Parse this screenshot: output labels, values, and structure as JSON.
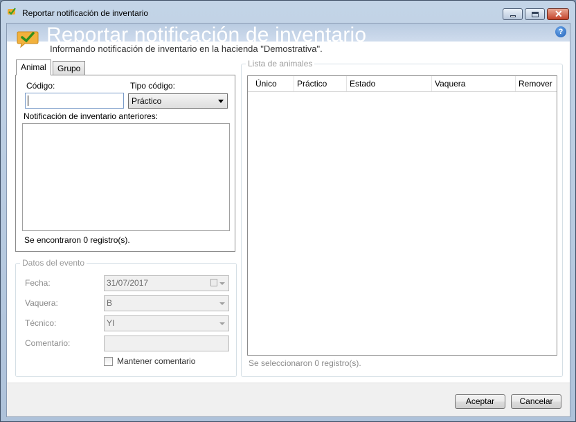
{
  "window": {
    "title": "Reportar notificación de inventario"
  },
  "header": {
    "title": "Reportar notificación de inventario",
    "subtitle": "Informando notificación de inventario en la hacienda \"Demostrativa\"."
  },
  "tabs": [
    {
      "label": "Animal",
      "active": true
    },
    {
      "label": "Grupo",
      "active": false
    }
  ],
  "animal_tab": {
    "codigo_label": "Código:",
    "codigo_value": "",
    "tipo_codigo_label": "Tipo código:",
    "tipo_codigo_value": "Práctico",
    "anteriores_label": "Notificación de inventario anteriores:",
    "registros_text": "Se encontraron 0 registro(s)."
  },
  "evento": {
    "title": "Datos del evento",
    "fecha_label": "Fecha:",
    "fecha_value": "31/07/2017",
    "vaquera_label": "Vaquera:",
    "vaquera_value": "B",
    "tecnico_label": "Técnico:",
    "tecnico_value": "YI",
    "comentario_label": "Comentario:",
    "comentario_value": "",
    "mantener_label": "Mantener comentario",
    "mantener_checked": false
  },
  "lista": {
    "title": "Lista de animales",
    "columns": [
      "Único",
      "Práctico",
      "Estado",
      "Vaquera",
      "Remover"
    ],
    "footer": "Se seleccionaron 0 registro(s)."
  },
  "buttons": {
    "aceptar": "Aceptar",
    "cancelar": "Cancelar"
  },
  "icons": {
    "title_icon": "check-bubble-icon",
    "header_icon": "check-bubble-icon",
    "help_icon": "help-icon",
    "help_glyph": "?"
  },
  "colors": {
    "frame": "#aec2da",
    "header_band": "#b9cbe1",
    "check_green": "#3a9d23",
    "bubble_orange": "#f0a830"
  }
}
